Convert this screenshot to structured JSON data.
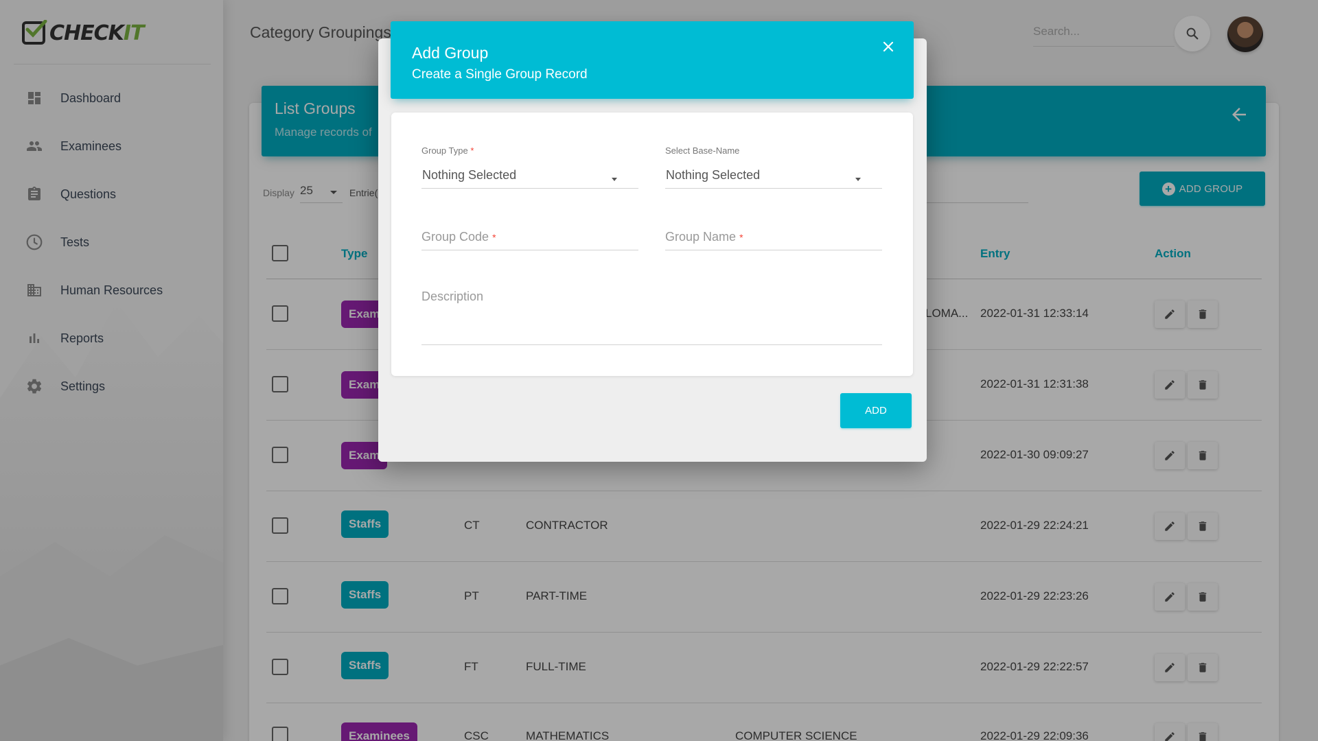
{
  "app": {
    "logo_main": "CHECK",
    "logo_accent": "IT"
  },
  "sidebar": {
    "items": [
      {
        "label": "Dashboard",
        "icon": "dashboard-icon"
      },
      {
        "label": "Examinees",
        "icon": "people-icon"
      },
      {
        "label": "Questions",
        "icon": "clipboard-icon"
      },
      {
        "label": "Tests",
        "icon": "clock-icon"
      },
      {
        "label": "Human Resources",
        "icon": "building-icon"
      },
      {
        "label": "Reports",
        "icon": "bar-chart-icon"
      },
      {
        "label": "Settings",
        "icon": "gear-icon"
      }
    ]
  },
  "header": {
    "title": "Category Groupings",
    "search_placeholder": "Search..."
  },
  "card": {
    "title": "List Groups",
    "subtitle": "Manage records of",
    "display_label": "Display",
    "display_value": "25",
    "entries_label": "Entrie(",
    "add_button": "ADD GROUP"
  },
  "table": {
    "headers": {
      "type": "Type",
      "entry": "Entry",
      "action": "Action"
    },
    "rows": [
      {
        "type": "Exam",
        "code": "",
        "name": "",
        "base": "LOMA...",
        "entry": "2022-01-31 12:33:14",
        "kind": "exam"
      },
      {
        "type": "Exam",
        "code": "",
        "name": "",
        "base": "",
        "entry": "2022-01-31 12:31:38",
        "kind": "exam"
      },
      {
        "type": "Exam",
        "code": "",
        "name": "",
        "base": "",
        "entry": "2022-01-30 09:09:27",
        "kind": "exam"
      },
      {
        "type": "Staffs",
        "code": "CT",
        "name": "CONTRACTOR",
        "base": "",
        "entry": "2022-01-29 22:24:21",
        "kind": "staff"
      },
      {
        "type": "Staffs",
        "code": "PT",
        "name": "PART-TIME",
        "base": "",
        "entry": "2022-01-29 22:23:26",
        "kind": "staff"
      },
      {
        "type": "Staffs",
        "code": "FT",
        "name": "FULL-TIME",
        "base": "",
        "entry": "2022-01-29 22:22:57",
        "kind": "staff"
      },
      {
        "type": "Examinees",
        "code": "CSC",
        "name": "MATHEMATICS",
        "base": "COMPUTER SCIENCE",
        "entry": "2022-01-29 22:09:36",
        "kind": "exam"
      }
    ]
  },
  "modal": {
    "title": "Add Group",
    "subtitle": "Create a Single Group Record",
    "group_type_label": "Group Type",
    "group_type_value": "Nothing Selected",
    "base_name_label": "Select Base-Name",
    "base_name_value": "Nothing Selected",
    "group_code_label": "Group Code",
    "group_name_label": "Group Name",
    "description_label": "Description",
    "required_mark": "*",
    "add_button": "ADD"
  },
  "colors": {
    "accent": "#00bcd4",
    "accent_dark": "#00acc1",
    "exam_badge": "#9c27b0",
    "required": "#f44336"
  }
}
